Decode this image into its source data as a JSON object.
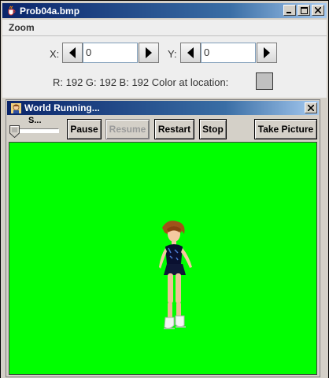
{
  "window": {
    "title": "Prob04a.bmp",
    "minimize": "_",
    "maximize": "□",
    "close": "✕"
  },
  "menu": {
    "zoom": "Zoom"
  },
  "coords": {
    "x_label": "X:",
    "x_value": "0",
    "y_label": "Y:",
    "y_value": "0"
  },
  "color_info": {
    "text": "R: 192 G: 192 B: 192 Color at location:",
    "swatch_color": "#c0c0c0"
  },
  "world_window": {
    "title": "World Running...",
    "close": "✕",
    "speed_label": "S...",
    "buttons": {
      "pause": "Pause",
      "resume": "Resume",
      "restart": "Restart",
      "stop": "Stop",
      "take_picture": "Take Picture"
    },
    "background_color": "#00ff00"
  },
  "colors": {
    "title_bar": "#0a246a",
    "chrome": "#d4d0c8",
    "panel": "#eeeeee"
  },
  "icons": [
    "java-cup-icon",
    "minimize-icon",
    "maximize-icon",
    "close-icon",
    "left-arrow-icon",
    "right-arrow-icon",
    "world-icon",
    "slider-thumb-icon"
  ]
}
